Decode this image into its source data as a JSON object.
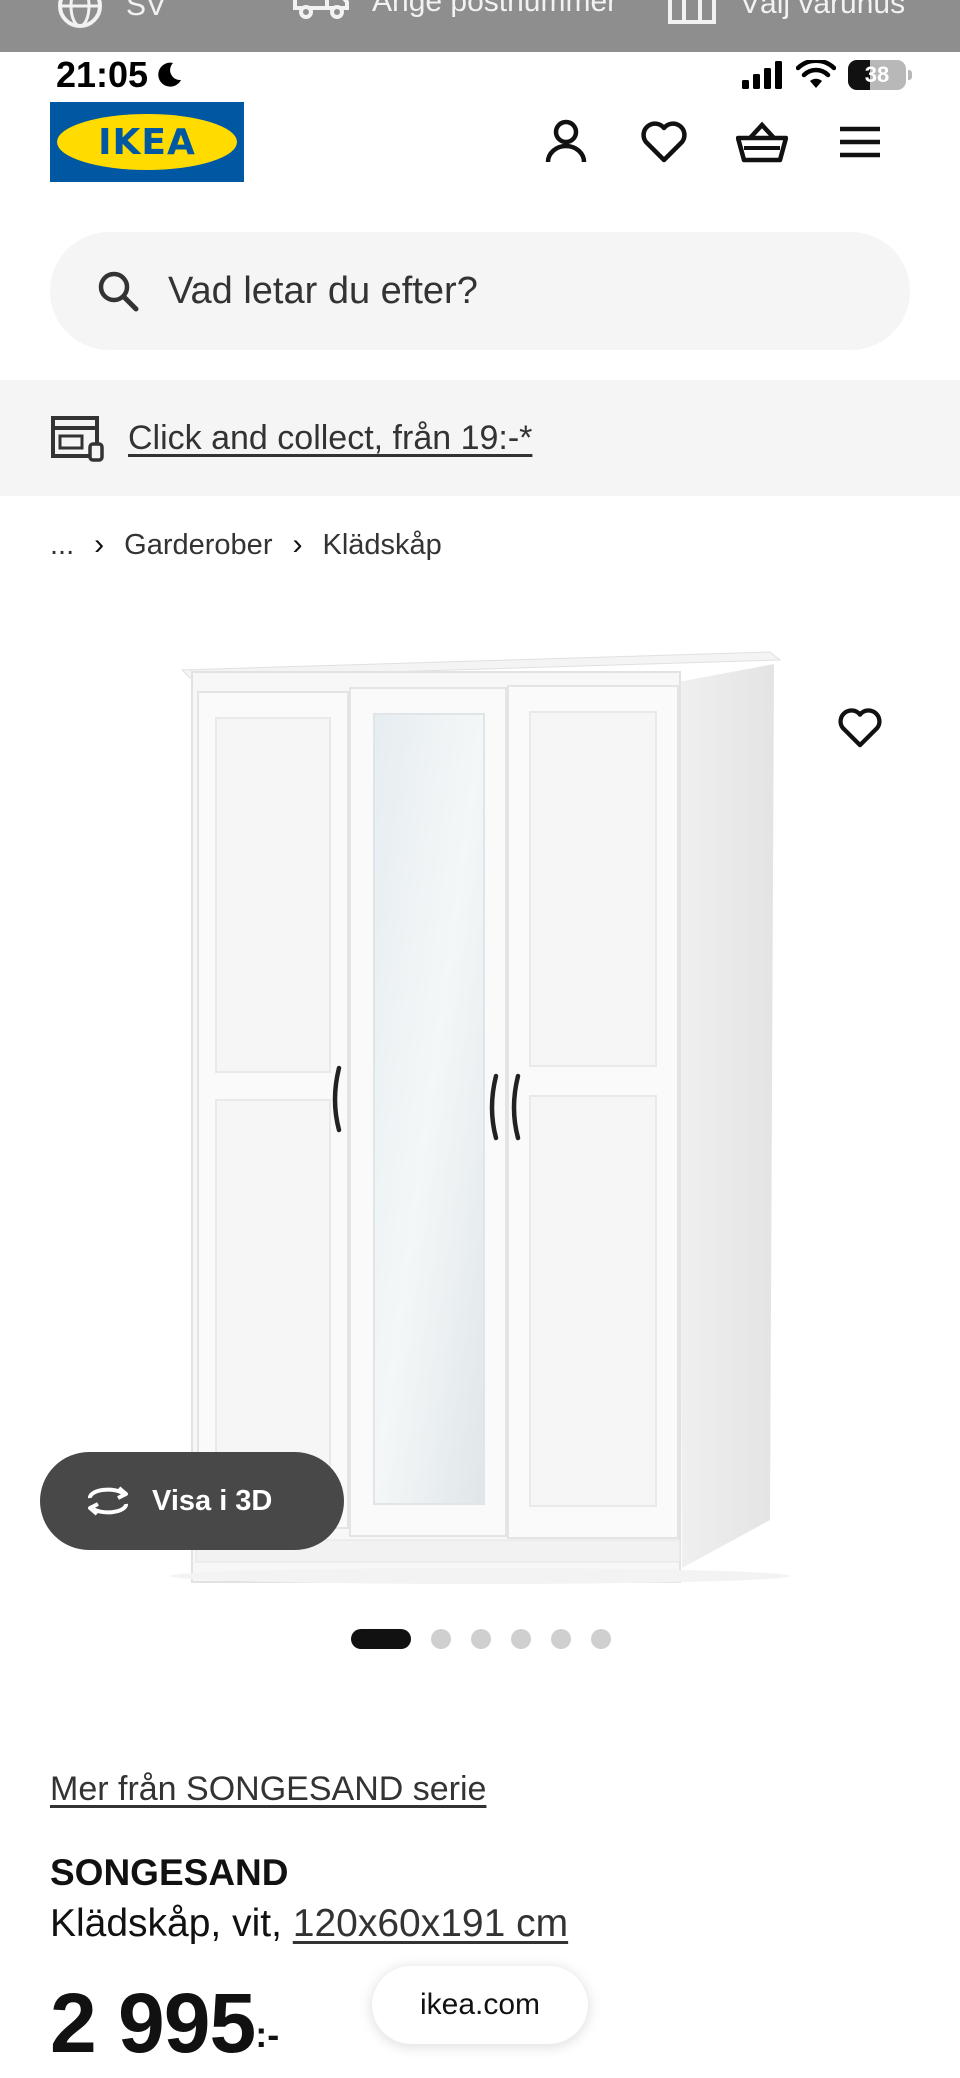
{
  "top_strip": {
    "language": "SV",
    "postcode": "Ange postnummer",
    "store": "Välj varuhus"
  },
  "status_bar": {
    "time": "21:05",
    "battery": "38"
  },
  "header": {
    "logo_text": "IKEA",
    "icons": [
      "account-icon",
      "heart-icon",
      "basket-icon",
      "menu-icon"
    ]
  },
  "search": {
    "placeholder": "Vad letar du efter?"
  },
  "click_collect": {
    "label": "Click and collect, från 19:-*"
  },
  "breadcrumb": {
    "ellipsis": "...",
    "items": [
      "Garderober",
      "Klädskåp"
    ]
  },
  "product": {
    "view_3d": "Visa i 3D",
    "series_link": "Mer från SONGESAND serie",
    "name": "SONGESAND",
    "desc_prefix": "Klädskåp, vit,",
    "size": "120x60x191 cm",
    "price": "2 995",
    "price_suffix": ":-"
  },
  "carousel": {
    "total": 6,
    "active": 1
  },
  "browser": {
    "url": "ikea.com"
  },
  "colors": {
    "ikea_blue": "#0058a3",
    "ikea_yellow": "#ffdb00",
    "pill_dark": "#484848",
    "bar_gray": "#f5f5f5"
  }
}
